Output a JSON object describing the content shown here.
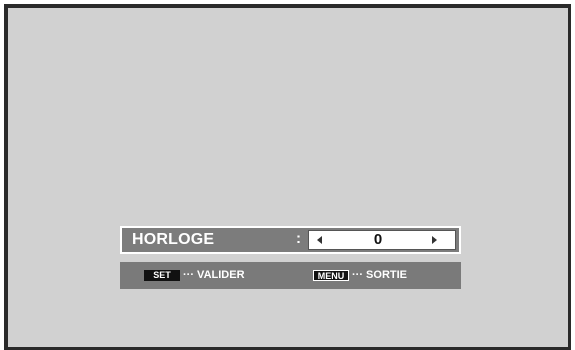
{
  "osd": {
    "setting": {
      "label": "HORLOGE",
      "separator": ":",
      "value": "0",
      "left_arrow": "left-arrow-icon",
      "right_arrow": "right-arrow-icon"
    },
    "help": {
      "set_key": "SET",
      "set_action": "··· VALIDER",
      "menu_key": "MENU",
      "menu_action": "··· SORTIE"
    },
    "colors": {
      "screen_bg": "#d1d1d1",
      "bar_bg": "#7c7c7c",
      "text": "#ffffff",
      "value_box": "#ffffff"
    }
  }
}
